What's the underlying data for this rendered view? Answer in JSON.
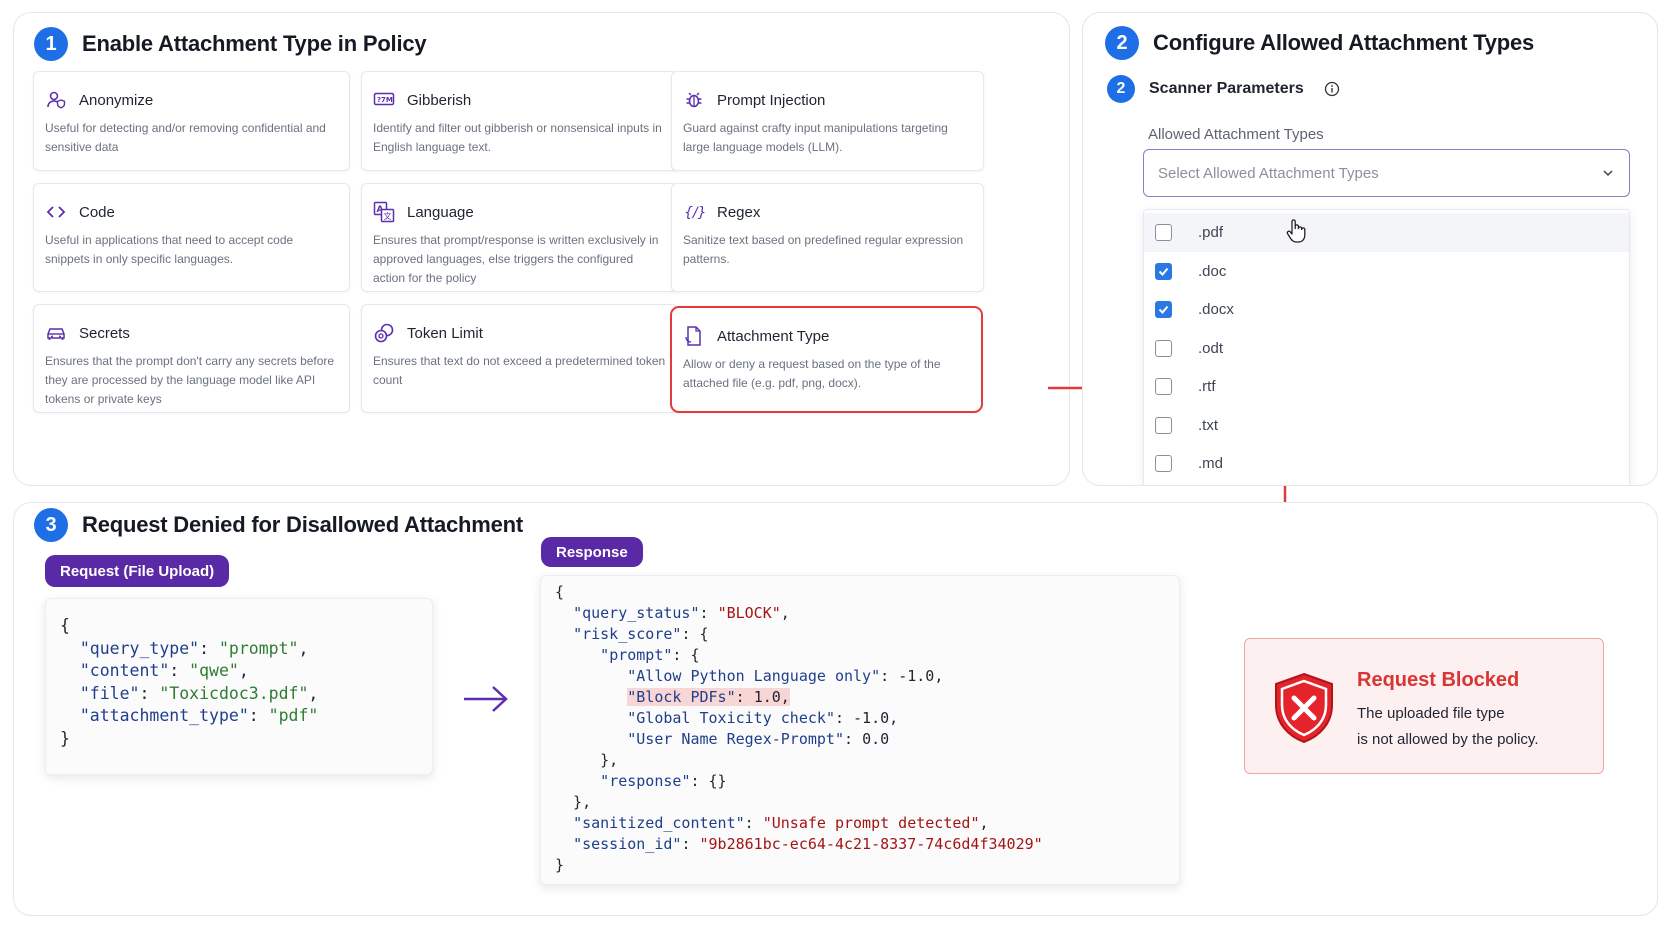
{
  "section1": {
    "number": "1",
    "title": "Enable Attachment Type in Policy",
    "cards": [
      {
        "icon": "user-shield-icon",
        "title": "Anonymize",
        "desc": "Useful for detecting and/or removing confidential and sensitive data"
      },
      {
        "icon": "text-box-icon",
        "title": "Gibberish",
        "desc": "Identify and filter out gibberish or nonsensical inputs in English language text."
      },
      {
        "icon": "bug-icon",
        "title": "Prompt Injection",
        "desc": "Guard against crafty input manipulations targeting large language models (LLM)."
      },
      {
        "icon": "code-icon",
        "title": "Code",
        "desc": "Useful in applications that need to accept code snippets in only specific languages."
      },
      {
        "icon": "translate-icon",
        "title": "Language",
        "desc": "Ensures that prompt/response is written exclusively in approved languages, else triggers the configured action for the policy"
      },
      {
        "icon": "regex-icon",
        "title": "Regex",
        "desc": "Sanitize text based on predefined regular expression patterns."
      },
      {
        "icon": "car-icon",
        "title": "Secrets",
        "desc": "Ensures that the prompt don't carry any secrets before they are processed by the language model like API tokens or private keys"
      },
      {
        "icon": "coins-icon",
        "title": "Token Limit",
        "desc": "Ensures that text do not exceed a predetermined token count"
      },
      {
        "icon": "document-icon",
        "title": "Attachment Type",
        "desc": "Allow or deny a request based on the type of the attached file (e.g. pdf, png, docx)."
      }
    ]
  },
  "section2": {
    "number": "2",
    "title": "Configure Allowed Attachment Types",
    "sub_number": "2",
    "sub_title": "Scanner Parameters",
    "field_label": "Allowed Attachment Types",
    "placeholder": "Select Allowed Attachment Types",
    "options": [
      {
        "label": ".pdf",
        "checked": false
      },
      {
        "label": ".doc",
        "checked": true
      },
      {
        "label": ".docx",
        "checked": true
      },
      {
        "label": ".odt",
        "checked": false
      },
      {
        "label": ".rtf",
        "checked": false
      },
      {
        "label": ".txt",
        "checked": false
      },
      {
        "label": ".md",
        "checked": false
      }
    ]
  },
  "section3": {
    "number": "3",
    "title": "Request Denied for Disallowed Attachment",
    "request_label": "Request (File Upload)",
    "response_label": "Response",
    "request": {
      "query_type": "prompt",
      "content": "qwe",
      "file": "Toxicdoc3.pdf",
      "attachment_type": "pdf"
    },
    "response": {
      "query_status": "BLOCK",
      "risk_score_key": "risk_score",
      "prompt_key": "prompt",
      "scores": [
        {
          "name": "Allow Python Language only",
          "value": "-1.0"
        },
        {
          "name": "Block PDFs",
          "value": "1.0"
        },
        {
          "name": "Global Toxicity check",
          "value": "-1.0"
        },
        {
          "name": "User Name Regex-Prompt",
          "value": "0.0"
        }
      ],
      "response_key": "response",
      "sanitized_content": "Unsafe prompt detected",
      "session_id": "9b2861bc-ec64-4c21-8337-74c6d4f34029"
    },
    "blocked": {
      "title": "Request Blocked",
      "line1": "The uploaded file type",
      "line2": "is not allowed by the policy."
    }
  },
  "colors": {
    "accent_blue": "#1e6fe6",
    "pill_purple": "#5a2aa6",
    "icon_purple": "#5b2fb0",
    "alert_red": "#e23b3b"
  }
}
